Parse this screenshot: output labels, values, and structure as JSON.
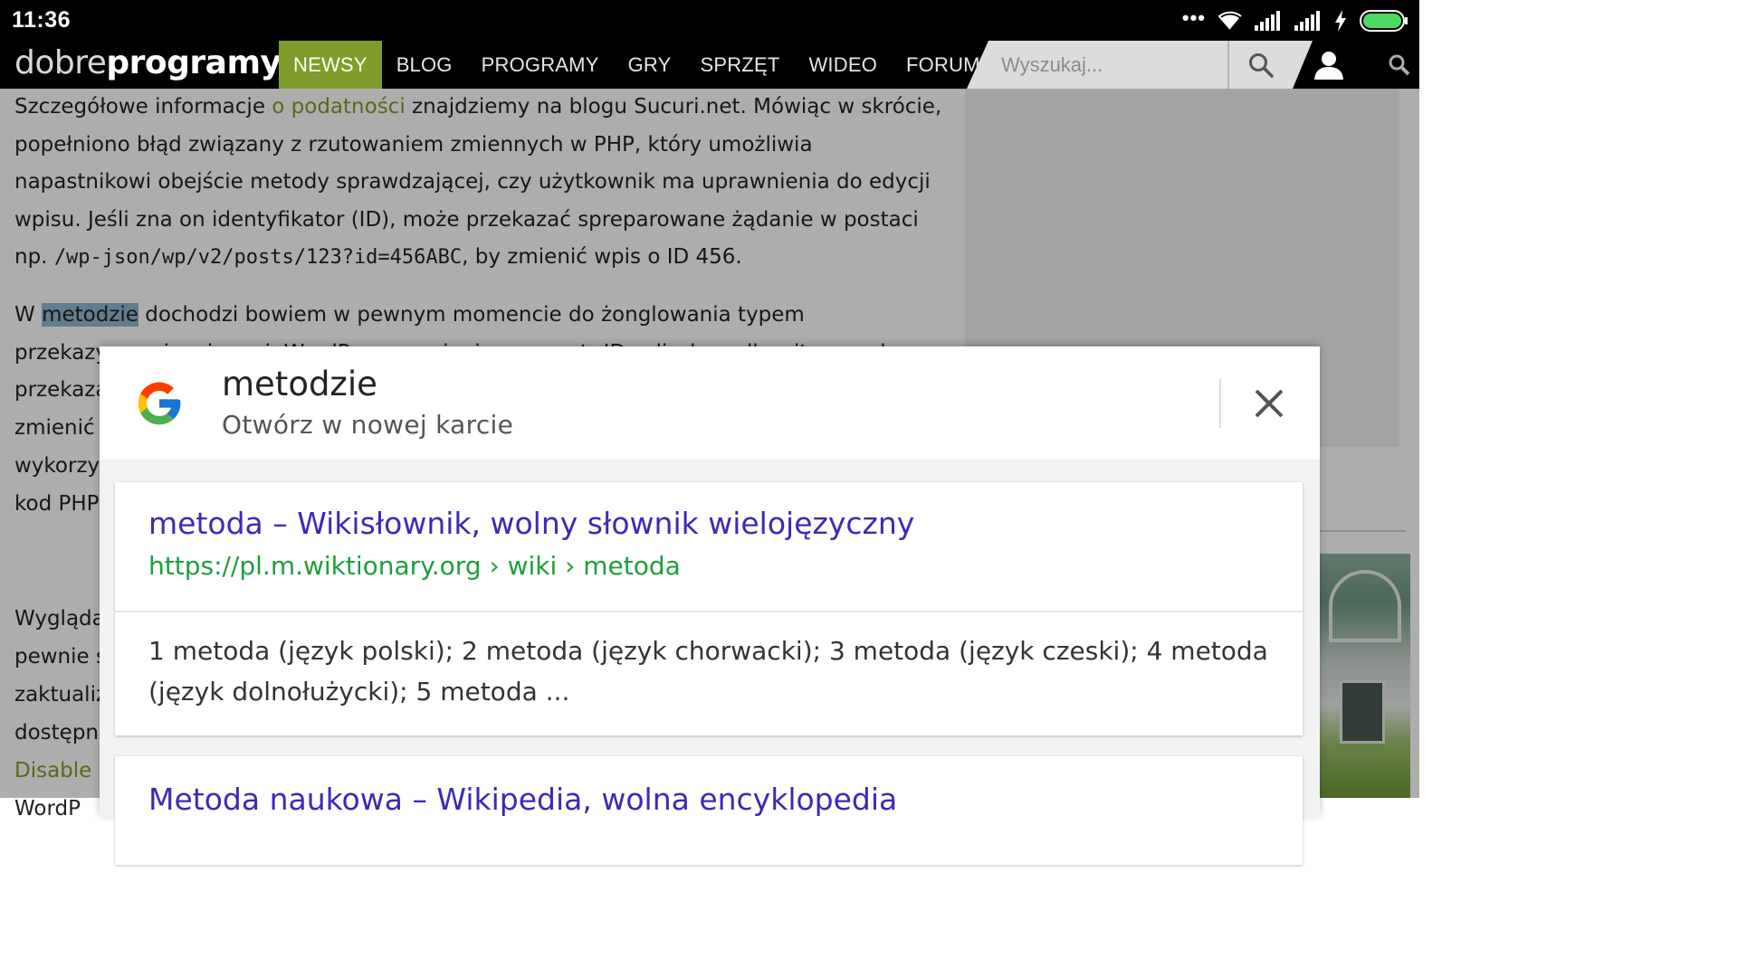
{
  "status_bar": {
    "time": "11:36",
    "icons": [
      "more-dots-icon",
      "wifi-icon",
      "signal-icon",
      "signal-icon",
      "charging-icon",
      "battery-icon"
    ],
    "more_label": "•••"
  },
  "site_nav": {
    "logo_light": "dobre",
    "logo_bold": "programy",
    "items": [
      "NEWSY",
      "BLOG",
      "PROGRAMY",
      "GRY",
      "SPRZĘT",
      "WIDEO",
      "FORUM"
    ],
    "active_item": "NEWSY",
    "search_placeholder": "Wyszukaj...",
    "accent_color": "#7f9d2a"
  },
  "article": {
    "p1_before": "Szczegółowe informacje ",
    "p1_link": "o podatności",
    "p1_mid": " znajdziemy na blogu Sucuri.net. Mówiąc w skrócie, popełniono błąd związany z rzutowaniem zmiennych w PHP, który umożliwia napastnikowi obejście metody sprawdzającej, czy użytkownik ma uprawnienia do edycji wpisu. Jeśli zna on identyfikator (ID), może przekazać spreparowane żądanie w postaci np. ",
    "p1_code": "/wp-json/wp/v2/posts/123?id=456ABC",
    "p1_end": ", by zmienić wpis o ID 456.",
    "p2_start": "W ",
    "p2_highlight": "metodzie",
    "p2_line1_rest": " dochodzi bowiem w pewnym momencie do żonglowania typem",
    "p2_line2": "przekazywanej zmiennej. WordPress zamienia parametr ID w liczbę całkowitą przed",
    "p2_partial": [
      "przekaza",
      "zmienić",
      "wykorzy",
      "kod PHP"
    ],
    "p3_partial": [
      "Wygląda",
      "pewnie s",
      "zaktualiz",
      "dostępn"
    ],
    "link_partial": "Disable",
    "last_partial": "WordP"
  },
  "google_popup": {
    "query": "metodzie",
    "open_in_new_tab": "Otwórz w nowej karcie",
    "results": [
      {
        "title": "metoda – Wikisłownik, wolny słownik wielojęzyczny",
        "url": "https://pl.m.wiktionary.org › wiki › metoda",
        "snippet": "1 metoda (język polski); 2 metoda (język chorwacki); 3 metoda (język czeski); 4 metoda (język dolnołużycki); 5 metoda ..."
      },
      {
        "title": "Metoda naukowa – Wikipedia, wolna encyklopedia"
      }
    ],
    "title_color": "#3a2bb5",
    "url_color": "#1e9e3b"
  }
}
